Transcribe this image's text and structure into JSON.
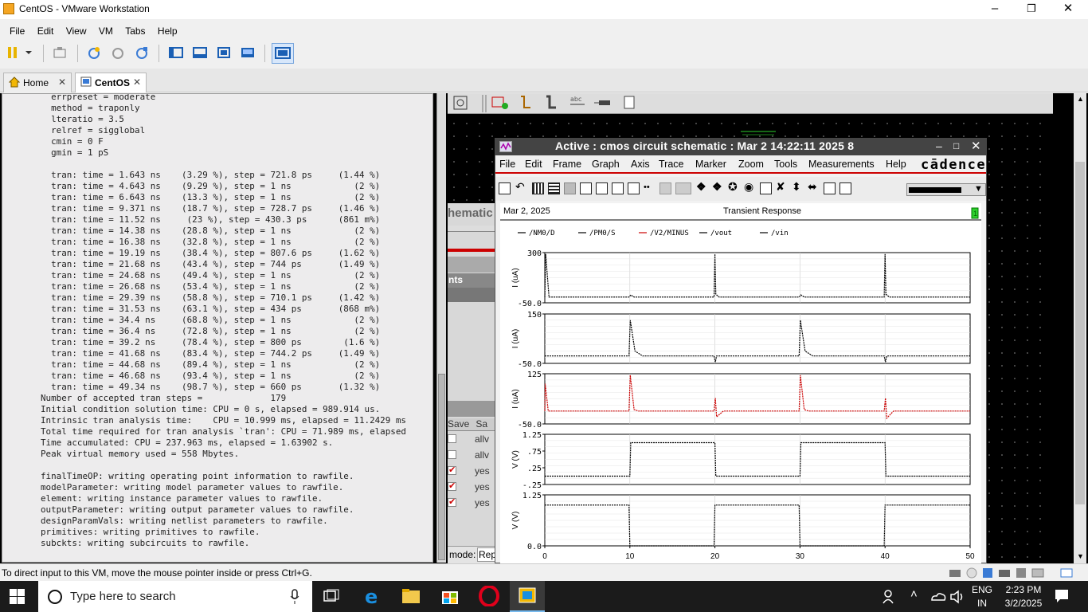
{
  "window": {
    "title": "CentOS - VMware Workstation"
  },
  "menu": [
    "File",
    "Edit",
    "View",
    "VM",
    "Tabs",
    "Help"
  ],
  "tabs": [
    {
      "label": "Home",
      "active": false
    },
    {
      "label": "CentOS",
      "active": true
    }
  ],
  "console_lines": [
    "  errpreset = moderate",
    "  method = traponly",
    "  lteratio = 3.5",
    "  relref = sigglobal",
    "  cmin = 0 F",
    "  gmin = 1 pS",
    "",
    "  tran: time = 1.643 ns    (3.29 %), step = 721.8 ps     (1.44 %)",
    "  tran: time = 4.643 ns    (9.29 %), step = 1 ns            (2 %)",
    "  tran: time = 6.643 ns    (13.3 %), step = 1 ns            (2 %)",
    "  tran: time = 9.371 ns    (18.7 %), step = 728.7 ps     (1.46 %)",
    "  tran: time = 11.52 ns     (23 %), step = 430.3 ps      (861 m%)",
    "  tran: time = 14.38 ns    (28.8 %), step = 1 ns            (2 %)",
    "  tran: time = 16.38 ns    (32.8 %), step = 1 ns            (2 %)",
    "  tran: time = 19.19 ns    (38.4 %), step = 807.6 ps     (1.62 %)",
    "  tran: time = 21.68 ns    (43.4 %), step = 744 ps       (1.49 %)",
    "  tran: time = 24.68 ns    (49.4 %), step = 1 ns            (2 %)",
    "  tran: time = 26.68 ns    (53.4 %), step = 1 ns            (2 %)",
    "  tran: time = 29.39 ns    (58.8 %), step = 710.1 ps     (1.42 %)",
    "  tran: time = 31.53 ns    (63.1 %), step = 434 ps       (868 m%)",
    "  tran: time = 34.4 ns     (68.8 %), step = 1 ns            (2 %)",
    "  tran: time = 36.4 ns     (72.8 %), step = 1 ns            (2 %)",
    "  tran: time = 39.2 ns     (78.4 %), step = 800 ps        (1.6 %)",
    "  tran: time = 41.68 ns    (83.4 %), step = 744.2 ps     (1.49 %)",
    "  tran: time = 44.68 ns    (89.4 %), step = 1 ns            (2 %)",
    "  tran: time = 46.68 ns    (93.4 %), step = 1 ns            (2 %)",
    "  tran: time = 49.34 ns    (98.7 %), step = 660 ps       (1.32 %)",
    "Number of accepted tran steps =             179",
    "Initial condition solution time: CPU = 0 s, elapsed = 989.914 us.",
    "Intrinsic tran analysis time:    CPU = 10.999 ms, elapsed = 11.2429 ms",
    "Total time required for tran analysis `tran': CPU = 71.989 ms, elapsed",
    "Time accumulated: CPU = 237.963 ms, elapsed = 1.63902 s.",
    "Peak virtual memory used = 558 Mbytes.",
    "",
    "finalTimeOP: writing operating point information to rawfile.",
    "modelParameter: writing model parameter values to rawfile.",
    "element: writing instance parameter values to rawfile.",
    "outputParameter: writing output parameter values to rawfile.",
    "designParamVals: writing netlist parameters to rawfile.",
    "primitives: writing primitives to rawfile.",
    "subckts: writing subcircuits to rawfile."
  ],
  "schematic": {
    "partial_title": "hematic",
    "partial_section": "nts",
    "save_header": "Save",
    "save_col2": "Sa",
    "rows": [
      {
        "checked": false,
        "value": "allv"
      },
      {
        "checked": false,
        "value": "allv"
      },
      {
        "checked": true,
        "value": "yes"
      },
      {
        "checked": true,
        "value": "yes"
      },
      {
        "checked": true,
        "value": "yes"
      }
    ],
    "mode_label": "mode:",
    "mode_value": "Rep"
  },
  "cadence": {
    "title": "Active : cmos circuit schematic : Mar  2 14:22:11 2025 8",
    "menu": [
      "File",
      "Edit",
      "Frame",
      "Graph",
      "Axis",
      "Trace",
      "Marker",
      "Zoom",
      "Tools",
      "Measurements",
      "Help"
    ],
    "logo": "cādence",
    "date": "Mar 2, 2025",
    "plot_title": "Transient Response",
    "badge": "1"
  },
  "chart_data": {
    "type": "line",
    "title": "Transient Response",
    "legend": [
      "/NM0/D",
      "/PM0/S",
      "/V2/MINUS",
      "/vout",
      "/vin"
    ],
    "legend_colors": [
      "#000000",
      "#000000",
      "#cc0000",
      "#000000",
      "#000000"
    ],
    "x_ticks": [
      "0",
      "10",
      "20",
      "30",
      "40",
      "50"
    ],
    "xlim": [
      0,
      50
    ],
    "panels": [
      {
        "series": "/NM0/D",
        "ylabel": "I (uA)",
        "ylim": [
          -50,
          300
        ],
        "y_ticks": [
          "300",
          "-50.0"
        ],
        "color": "#000000",
        "x": [
          0,
          0.1,
          0.5,
          1,
          9.9,
          10.1,
          10.5,
          11,
          19.9,
          20,
          20.1,
          20.5,
          21,
          29.9,
          30.1,
          30.5,
          31,
          39.9,
          40,
          40.1,
          40.5,
          41,
          50
        ],
        "y": [
          -10,
          290,
          -10,
          -10,
          -10,
          5,
          -10,
          -10,
          -10,
          290,
          10,
          -10,
          -10,
          -10,
          5,
          -10,
          -10,
          -10,
          290,
          10,
          -10,
          -10,
          -10
        ]
      },
      {
        "series": "/PM0/S",
        "ylabel": "I (uA)",
        "ylim": [
          -50,
          150
        ],
        "y_ticks": [
          "150",
          "-50.0"
        ],
        "color": "#000000",
        "x": [
          0,
          9.9,
          10.05,
          10.6,
          11.5,
          19.9,
          20.05,
          20.2,
          29.9,
          30.05,
          30.6,
          31.5,
          39.9,
          40.05,
          40.2,
          50
        ],
        "y": [
          -20,
          -20,
          125,
          0,
          -20,
          -20,
          -45,
          -20,
          -20,
          125,
          0,
          -20,
          -20,
          -45,
          -20,
          -20
        ]
      },
      {
        "series": "/V2/MINUS",
        "ylabel": "I (uA)",
        "ylim": [
          -50,
          125
        ],
        "y_ticks": [
          "125",
          "-50.0"
        ],
        "color": "#cc0000",
        "x": [
          0,
          0.05,
          0.4,
          1,
          9.9,
          10.05,
          10.5,
          11,
          19.9,
          20.05,
          20.2,
          21,
          29.9,
          30.05,
          30.5,
          31,
          39.9,
          40.05,
          40.2,
          41,
          50
        ],
        "y": [
          -5,
          90,
          -5,
          -5,
          -5,
          120,
          0,
          -5,
          -5,
          40,
          -25,
          -5,
          -5,
          120,
          0,
          -5,
          -5,
          40,
          -30,
          -5,
          -5
        ]
      },
      {
        "series": "/vout",
        "ylabel": "V (V)",
        "ylim": [
          -0.25,
          1.25
        ],
        "y_ticks": [
          "1.25",
          ".75",
          ".25",
          "-.25"
        ],
        "color": "#000000",
        "x": [
          0,
          10,
          10.1,
          20,
          20.1,
          30,
          30.1,
          40,
          40.1,
          50
        ],
        "y": [
          0,
          0,
          1.0,
          1.0,
          0,
          0,
          1.0,
          1.0,
          0,
          0
        ]
      },
      {
        "series": "/vin",
        "ylabel": "V (V)",
        "ylim": [
          0,
          1.25
        ],
        "y_ticks": [
          "1.25",
          "0.0"
        ],
        "color": "#000000",
        "x": [
          0,
          9.9,
          10,
          19.9,
          20,
          29.9,
          30,
          39.9,
          40,
          50
        ],
        "y": [
          1.0,
          1.0,
          0,
          0,
          1.0,
          1.0,
          0,
          0,
          1.0,
          1.0
        ]
      }
    ]
  },
  "statusbar": {
    "text": "To direct input to this VM, move the mouse pointer inside or press Ctrl+G."
  },
  "taskbar": {
    "search_placeholder": "Type here to search",
    "lang1": "ENG",
    "lang2": "IN",
    "time": "2:23 PM",
    "date": "3/2/2025"
  },
  "colors": {
    "accent": "#c00000",
    "taskbar": "#1b1b1b"
  }
}
